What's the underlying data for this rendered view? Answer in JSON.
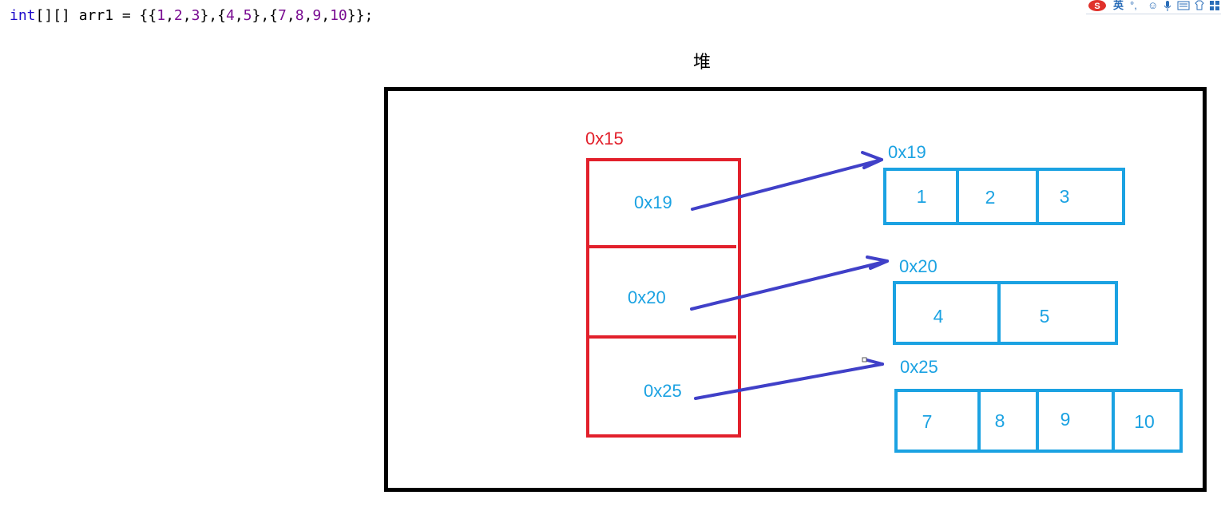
{
  "code": {
    "line_tokens": [
      {
        "t": "int",
        "c": "kw"
      },
      {
        "t": "[][] arr1 = {{",
        "c": ""
      },
      {
        "t": "1",
        "c": "num"
      },
      {
        "t": ",",
        "c": ""
      },
      {
        "t": "2",
        "c": "num"
      },
      {
        "t": ",",
        "c": ""
      },
      {
        "t": "3",
        "c": "num"
      },
      {
        "t": "},{",
        "c": ""
      },
      {
        "t": "4",
        "c": "num"
      },
      {
        "t": ",",
        "c": ""
      },
      {
        "t": "5",
        "c": "num"
      },
      {
        "t": "},{",
        "c": ""
      },
      {
        "t": "7",
        "c": "num"
      },
      {
        "t": ",",
        "c": ""
      },
      {
        "t": "8",
        "c": "num"
      },
      {
        "t": ",",
        "c": ""
      },
      {
        "t": "9",
        "c": "num"
      },
      {
        "t": ",",
        "c": ""
      },
      {
        "t": "10",
        "c": "num"
      },
      {
        "t": "}};",
        "c": ""
      }
    ]
  },
  "heap": {
    "title": "堆",
    "outer_array": {
      "address": "0x15",
      "cells": [
        "0x19",
        "0x20",
        "0x25"
      ]
    },
    "inner_arrays": [
      {
        "address": "0x19",
        "values": [
          "1",
          "2",
          "3"
        ]
      },
      {
        "address": "0x20",
        "values": [
          "4",
          "5"
        ]
      },
      {
        "address": "0x25",
        "values": [
          "7",
          "8",
          "9",
          "10"
        ]
      }
    ]
  },
  "colors": {
    "outer_array": "#e2202b",
    "inner_array": "#1ba2e2",
    "arrow": "#4040c8",
    "border": "#000000"
  },
  "ime_toolbar": {
    "icons": [
      "sogou-logo-icon",
      "english-mode-icon",
      "punctuation-icon",
      "emoji-icon",
      "microphone-icon",
      "keyboard-icon",
      "skin-icon",
      "toolbox-icon"
    ],
    "mode_label": "英"
  }
}
